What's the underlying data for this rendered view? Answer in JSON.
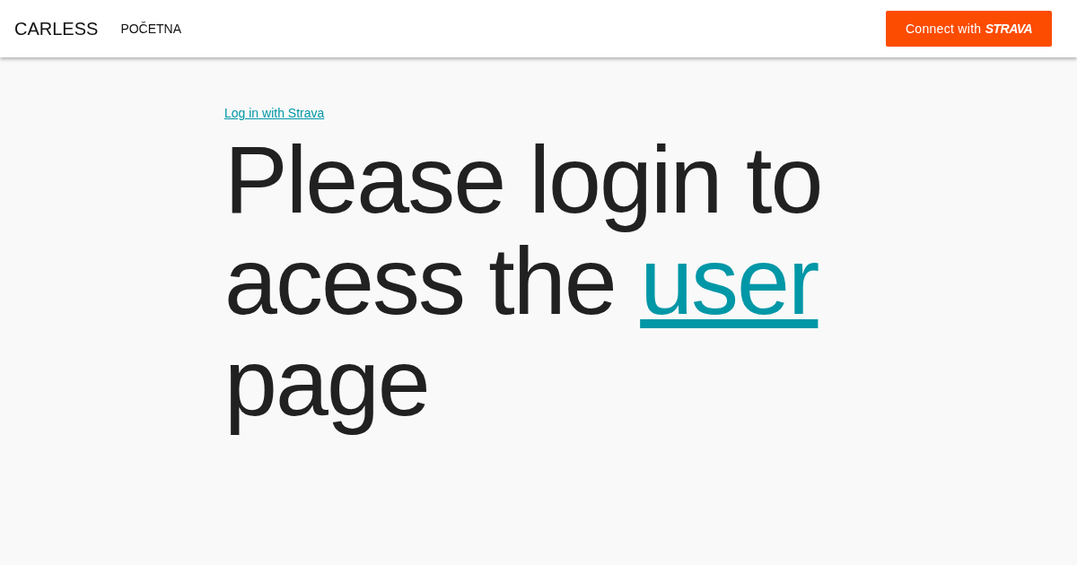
{
  "header": {
    "brand": "CARLESS",
    "nav": [
      {
        "label": "POČETNA"
      }
    ],
    "connect_button": {
      "label": "Connect with",
      "brand": "STRAVA"
    }
  },
  "main": {
    "login_link": "Log in with Strava",
    "heading": {
      "before": "Please login to acess the",
      "link": "user",
      "after": "page"
    }
  }
}
